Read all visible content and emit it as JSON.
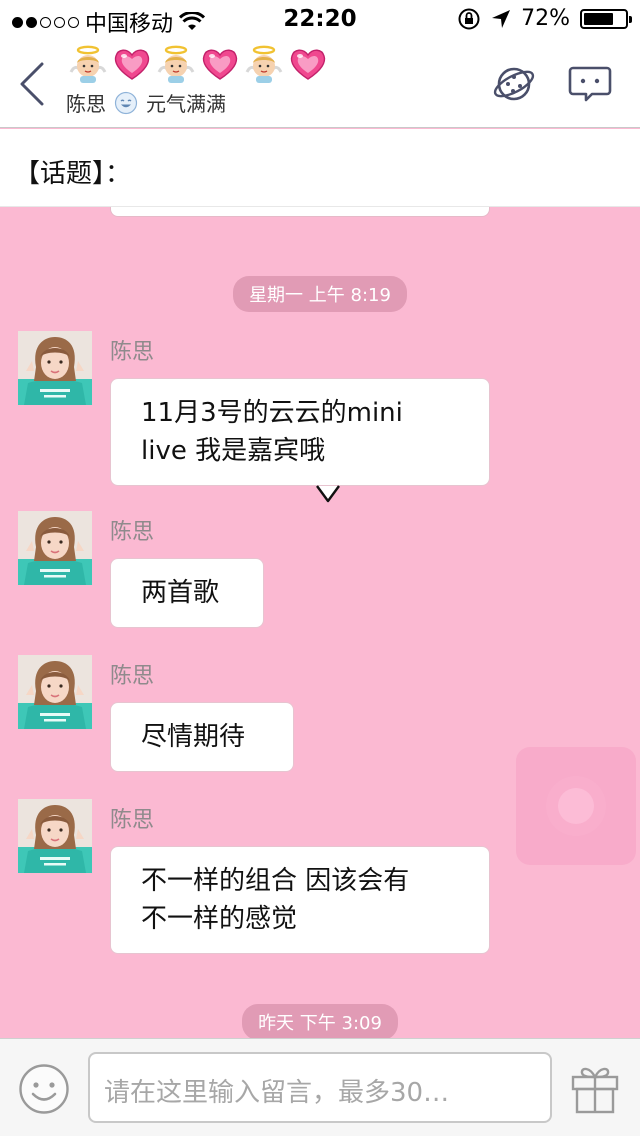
{
  "status_bar": {
    "signal_bars_filled": 2,
    "signal_bars_total": 5,
    "carrier": "中国移动",
    "time": "22:20",
    "battery_percent": "72%",
    "battery_level": 0.72
  },
  "nav": {
    "title_emojis": [
      "angel",
      "heart",
      "angel",
      "heart",
      "angel",
      "heart"
    ],
    "sender_name": "陈思",
    "status": "元气满满"
  },
  "topic": {
    "label": "【话题】："
  },
  "chat": {
    "timestamp_1": "星期一 上午 8:19",
    "messages": [
      {
        "sender": "陈思",
        "text_lines": [
          "11月3号的云云的mini",
          "live 我是嘉宾哦"
        ]
      },
      {
        "sender": "陈思",
        "text_lines": [
          "两首歌"
        ]
      },
      {
        "sender": "陈思",
        "text_lines": [
          "尽情期待"
        ]
      },
      {
        "sender": "陈思",
        "text_lines": [
          "不一样的组合 因该会有",
          "不一样的感觉"
        ]
      }
    ],
    "timestamp_2": "昨天 下午 3:09"
  },
  "input": {
    "placeholder": "请在这里输入留言，最多30…"
  },
  "colors": {
    "chat_background": "#fbb9d2",
    "timestamp_bg": "#e19bb5",
    "heart": "#f0488f"
  }
}
